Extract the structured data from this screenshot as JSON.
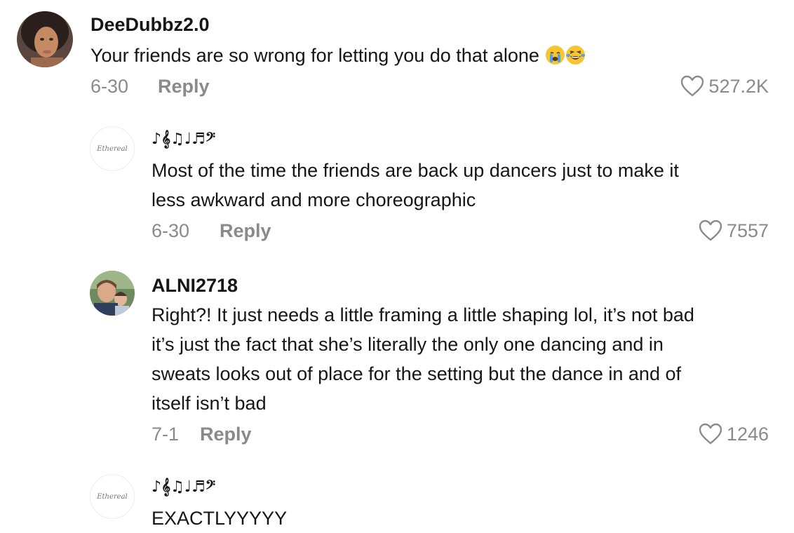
{
  "comments": [
    {
      "username": "DeeDubbz2.0",
      "text": "Your friends are so wrong for letting you do that alone",
      "emojis": [
        "loudly-crying-face",
        "face-with-tears-of-joy"
      ],
      "date": "6-30",
      "reply_label": "Reply",
      "likes": "527.2K"
    },
    {
      "username": "♪𝄞♫♩♬𝄢",
      "avatar_text": "Ethereal",
      "text_lines": [
        "Most of the time the friends are back up dancers just to make it",
        "less awkward and more choreographic"
      ],
      "date": "6-30",
      "reply_label": "Reply",
      "likes": "7557"
    },
    {
      "username": "ALNI2718",
      "text_lines": [
        "Right?! It just needs a little framing a little shaping lol, it’s not bad",
        "it’s just the fact that she’s literally the only one dancing and in",
        "sweats looks out of place for the setting but the dance in and of",
        "itself isn’t bad"
      ],
      "date": "7-1",
      "reply_label": "Reply",
      "likes": "1246"
    },
    {
      "username": "♪𝄞♫♩♬𝄢",
      "avatar_text": "Ethereal",
      "text": "EXACTLYYYYY"
    }
  ],
  "colors": {
    "text": "#161616",
    "muted": "#8a8a8a",
    "heart_stroke": "#8a8a8a"
  },
  "icons": {
    "like": "heart-outline-icon"
  }
}
